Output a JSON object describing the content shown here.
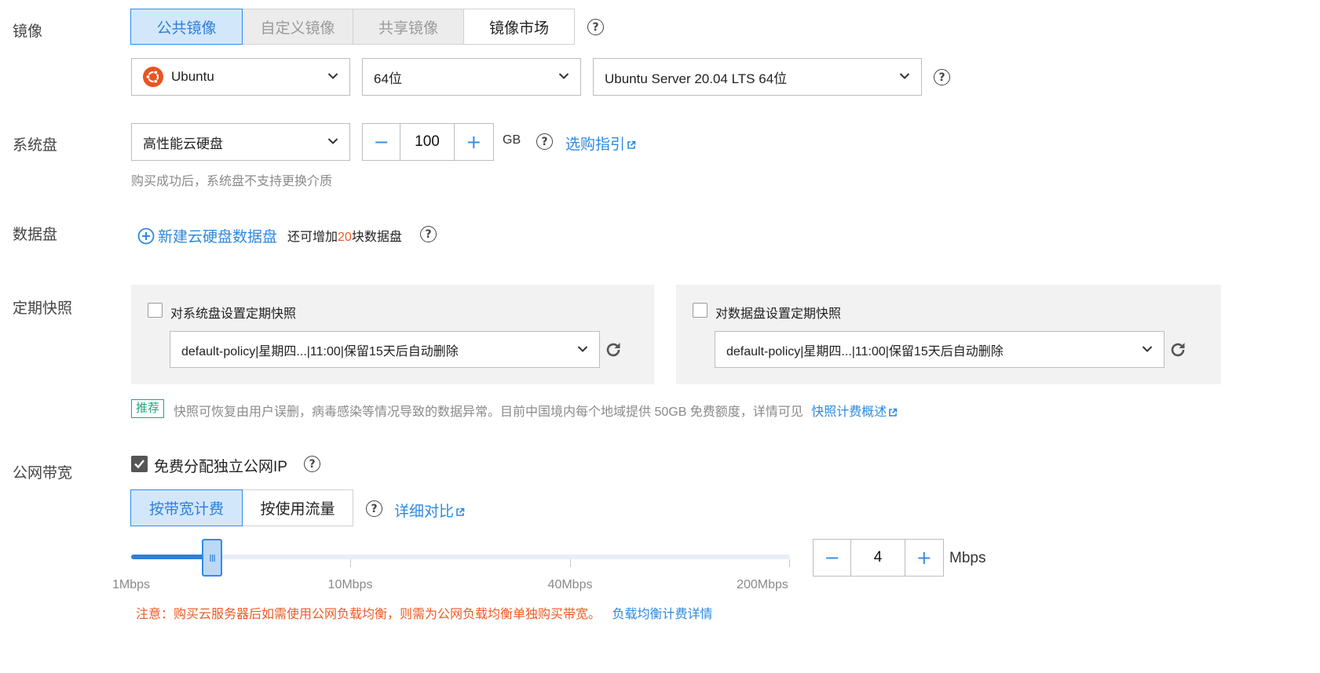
{
  "labels": {
    "image": "镜像",
    "system_disk": "系统盘",
    "data_disk": "数据盘",
    "snapshot": "定期快照",
    "bandwidth": "公网带宽"
  },
  "image_tabs": [
    "公共镜像",
    "自定义镜像",
    "共享镜像",
    "镜像市场"
  ],
  "image_select": {
    "os": "Ubuntu",
    "arch": "64位",
    "version": "Ubuntu Server 20.04 LTS 64位"
  },
  "system_disk": {
    "type": "高性能云硬盘",
    "size": "100",
    "unit": "GB",
    "guide_link": "选购指引",
    "note": "购买成功后，系统盘不支持更换介质"
  },
  "data_disk": {
    "add_link": "新建云硬盘数据盘",
    "quota_prefix": "还可增加",
    "quota_count": "20",
    "quota_suffix": "块数据盘"
  },
  "snapshot": {
    "system_checkbox_label": "对系统盘设置定期快照",
    "system_policy": "default-policy|星期四...|11:00|保留15天后自动删除",
    "data_checkbox_label": "对数据盘设置定期快照",
    "data_policy": "default-policy|星期四...|11:00|保留15天后自动删除",
    "recommend_tag": "推荐",
    "recommend_text": "快照可恢复由用户误删，病毒感染等情况导致的数据异常。目前中国境内每个地域提供 50GB 免费额度，详情可见",
    "pricing_link": "快照计费概述"
  },
  "bandwidth": {
    "free_ip_label": "免费分配独立公网IP",
    "free_ip_checked": true,
    "billing_tabs": [
      "按带宽计费",
      "按使用流量"
    ],
    "compare_link": "详细对比",
    "slider_ticks": [
      "1Mbps",
      "10Mbps",
      "40Mbps",
      "200Mbps"
    ],
    "value": "4",
    "unit": "Mbps",
    "notice": "注意：购买云服务器后如需使用公网负载均衡，则需为公网负载均衡单独购买带宽。",
    "lb_link": "负载均衡计费详情"
  },
  "colors": {
    "accent": "#2d8cf0",
    "link": "#2d8ae0",
    "warning": "#f05a24",
    "recommend": "#1ea67a",
    "ubuntu": "#e95420"
  }
}
